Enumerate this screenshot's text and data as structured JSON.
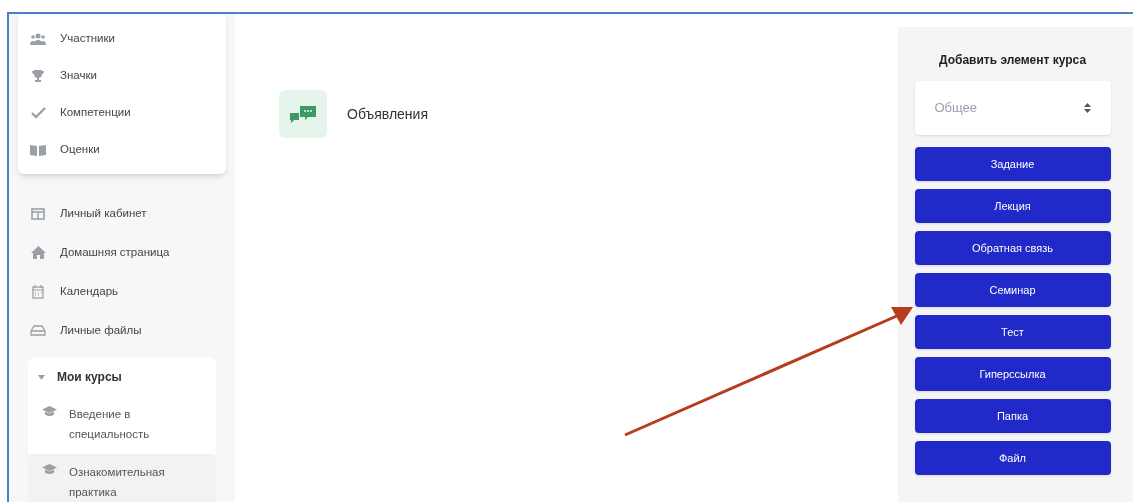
{
  "sidebar": {
    "course_menu": [
      {
        "label": "Участники"
      },
      {
        "label": "Значки"
      },
      {
        "label": "Компетенции"
      },
      {
        "label": "Оценки"
      }
    ],
    "nav_items": [
      {
        "label": "Личный кабинет"
      },
      {
        "label": "Домашняя страница"
      },
      {
        "label": "Календарь"
      },
      {
        "label": "Личные файлы"
      }
    ],
    "my_courses": {
      "title": "Мои курсы",
      "expanded": true,
      "courses": [
        {
          "label": "Введение в специальность",
          "selected": false
        },
        {
          "label": "Ознакомительная практика",
          "selected": true
        }
      ]
    }
  },
  "main": {
    "activities": [
      {
        "label": "Объявления"
      }
    ]
  },
  "add_panel": {
    "title": "Добавить элемент курса",
    "section_select": {
      "value": "Общее"
    },
    "buttons": [
      "Задание",
      "Лекция",
      "Обратная связь",
      "Семинар",
      "Тест",
      "Гиперссылка",
      "Папка",
      "Файл"
    ]
  }
}
